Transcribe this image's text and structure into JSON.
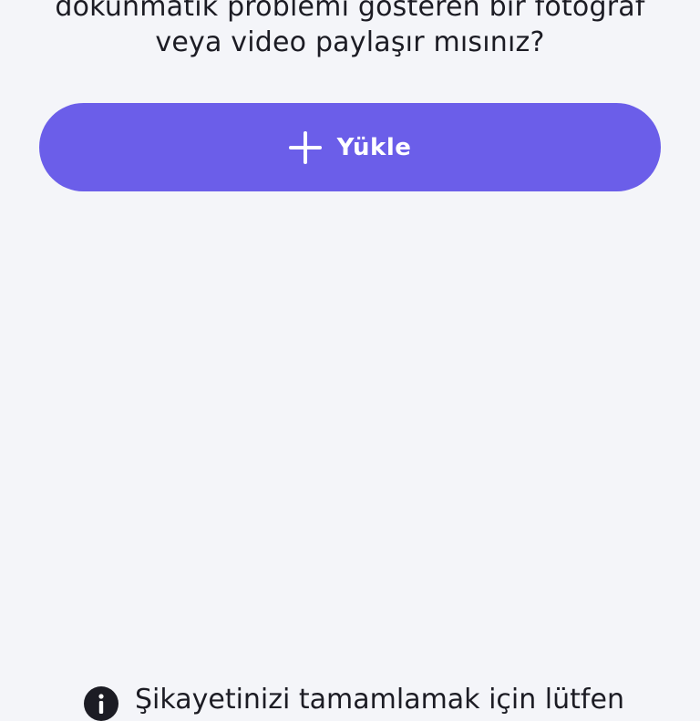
{
  "prompt": {
    "line1": "dokunmatik problemi gösteren bir fotoğraf",
    "line2": "veya video paylaşır mısınız?"
  },
  "upload_button": {
    "label": "Yükle",
    "icon": "plus-icon",
    "color": "#6b5ee9"
  },
  "footer": {
    "icon": "info-icon",
    "text": "Şikayetinizi tamamlamak için lütfen"
  },
  "colors": {
    "background": "#f4f5f9",
    "text": "#1c1c24",
    "accent": "#6b5ee9"
  }
}
